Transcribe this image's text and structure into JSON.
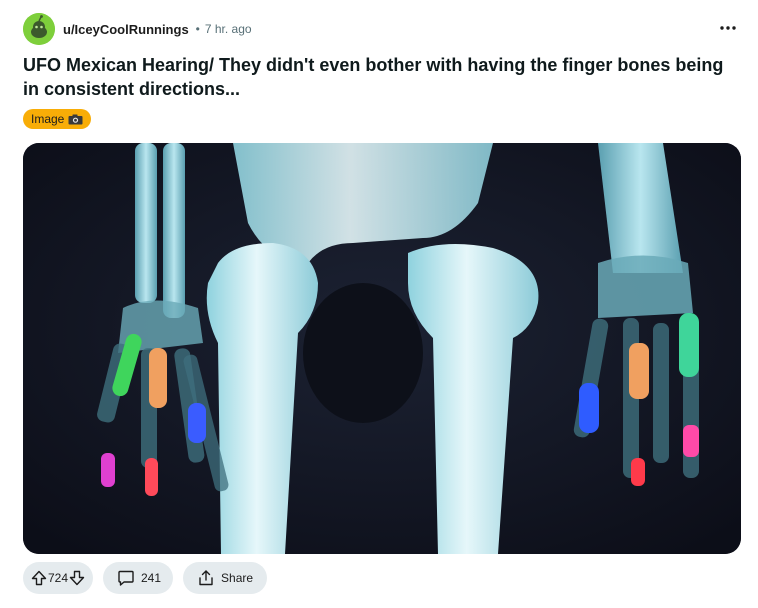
{
  "post": {
    "author": "u/IceyCoolRunnings",
    "separator": "•",
    "time": "7 hr. ago",
    "overflow_label": "•••",
    "title": "UFO Mexican Hearing/ They didn't even bother with having the finger bones being in consistent directions...",
    "flair": "Image",
    "votes": "724",
    "comments": "241",
    "share_label": "Share"
  },
  "colors": {
    "flair_bg": "#f8ad07",
    "pill_bg": "#e5ebee",
    "avatar_bg": "#7ecf3b"
  },
  "icons": {
    "avatar": "snoo-avatar-icon",
    "overflow": "more-horizontal-icon",
    "flair": "camera-icon",
    "upvote": "upvote-arrow-icon",
    "downvote": "downvote-arrow-icon",
    "comment": "comment-bubble-icon",
    "share": "share-icon"
  }
}
